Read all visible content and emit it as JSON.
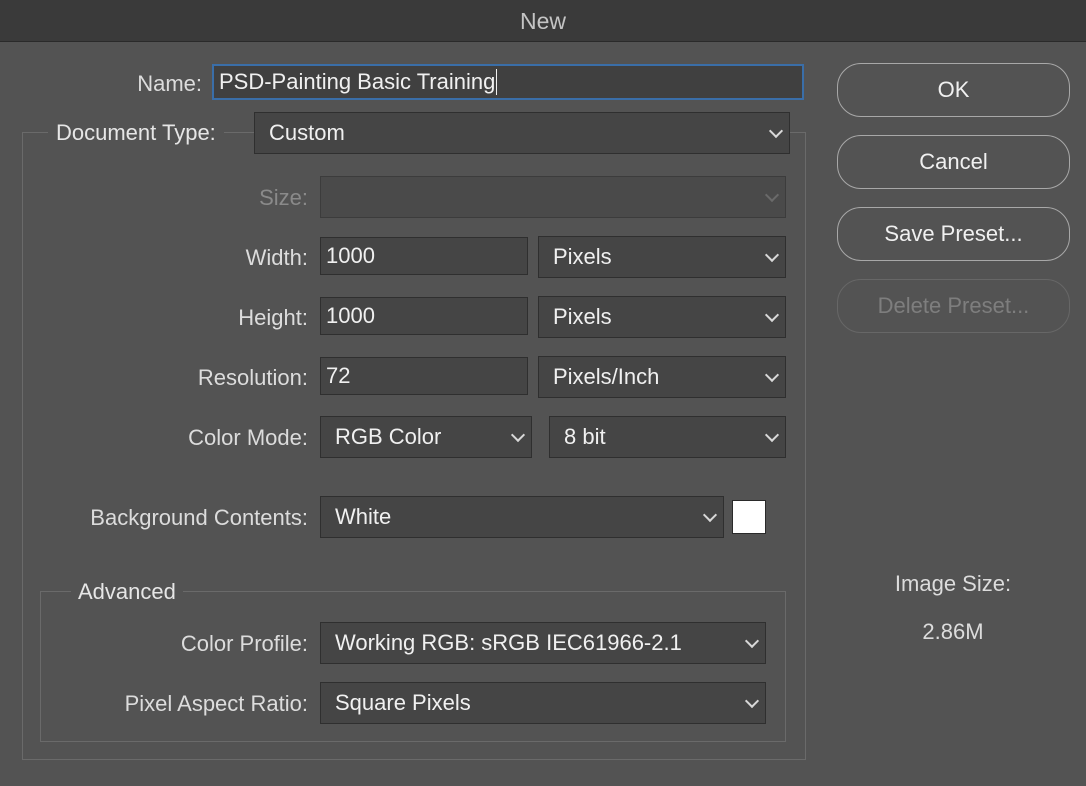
{
  "window": {
    "title": "New"
  },
  "name": {
    "label": "Name:",
    "value": "PSD-Painting Basic Training"
  },
  "document_type": {
    "label": "Document Type:",
    "value": "Custom"
  },
  "size": {
    "label": "Size:",
    "value": ""
  },
  "width": {
    "label": "Width:",
    "value": "1000",
    "unit": "Pixels"
  },
  "height": {
    "label": "Height:",
    "value": "1000",
    "unit": "Pixels"
  },
  "resolution": {
    "label": "Resolution:",
    "value": "72",
    "unit": "Pixels/Inch"
  },
  "color_mode": {
    "label": "Color Mode:",
    "value": "RGB Color",
    "depth": "8 bit"
  },
  "background": {
    "label": "Background Contents:",
    "value": "White",
    "swatch_color": "#ffffff"
  },
  "advanced": {
    "legend": "Advanced",
    "color_profile": {
      "label": "Color Profile:",
      "value": "Working RGB:  sRGB IEC61966-2.1"
    },
    "pixel_aspect": {
      "label": "Pixel Aspect Ratio:",
      "value": "Square Pixels"
    }
  },
  "buttons": {
    "ok": "OK",
    "cancel": "Cancel",
    "save_preset": "Save Preset...",
    "delete_preset": "Delete Preset..."
  },
  "image_size": {
    "label": "Image Size:",
    "value": "2.86M"
  }
}
